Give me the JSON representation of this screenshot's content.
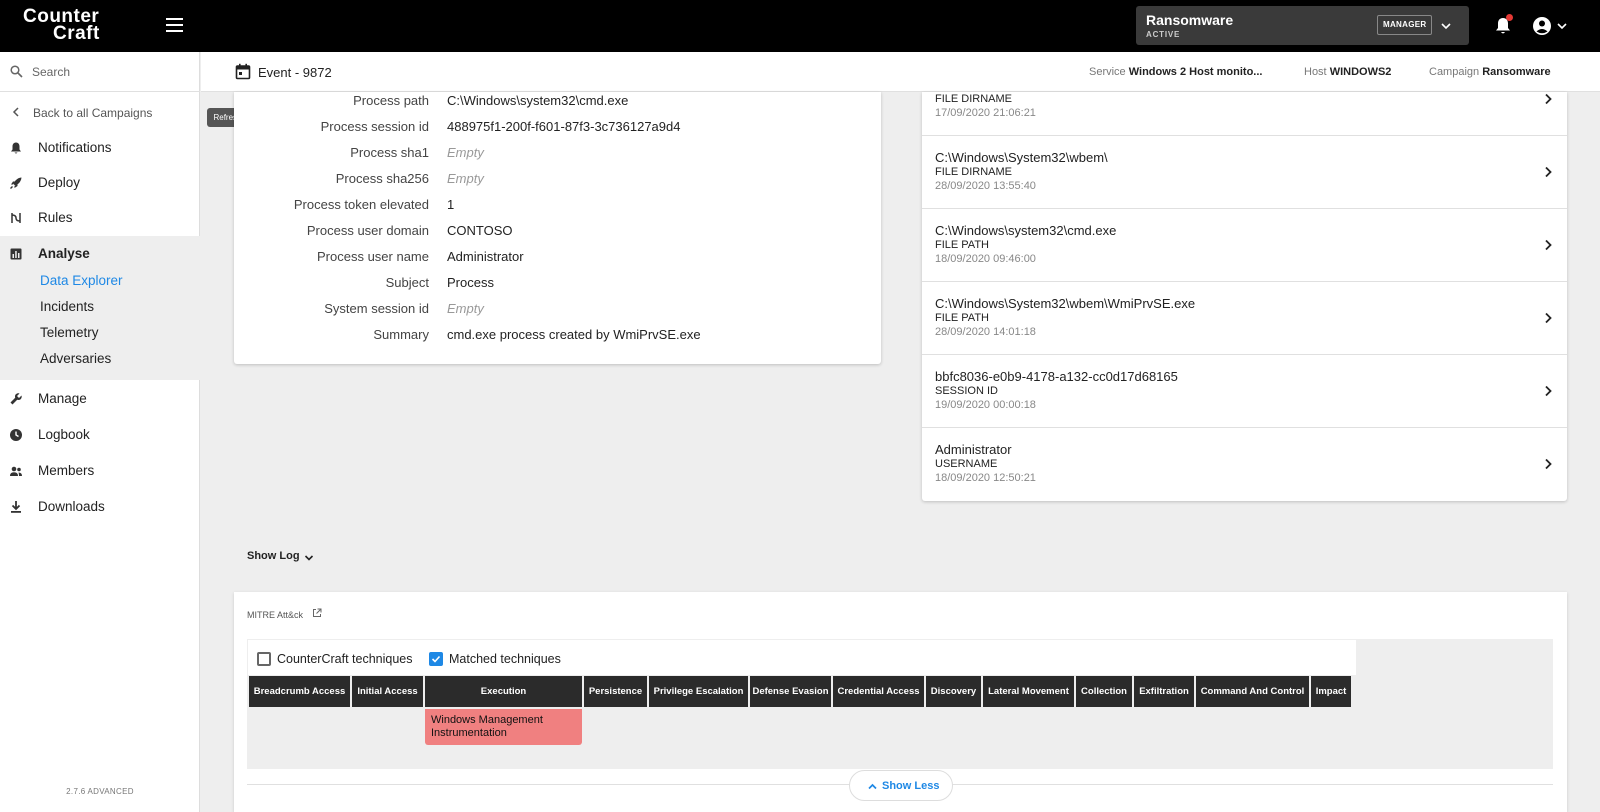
{
  "app": {
    "logo_line1": "Counter",
    "logo_line2": "Craft",
    "version": "2.7.6 ADVANCED"
  },
  "header": {
    "campaign_name": "Ransomware",
    "campaign_status": "ACTIVE",
    "role_badge": "MANAGER"
  },
  "sidebar": {
    "search_placeholder": "Search",
    "back_label": "Back to all Campaigns",
    "refresh_tooltip": "Refresh",
    "items": [
      {
        "label": "Notifications",
        "icon": "bell-icon"
      },
      {
        "label": "Deploy",
        "icon": "rocket-icon"
      },
      {
        "label": "Rules",
        "icon": "rules-icon"
      },
      {
        "label": "Analyse",
        "icon": "chart-icon"
      },
      {
        "label": "Manage",
        "icon": "wrench-icon"
      },
      {
        "label": "Logbook",
        "icon": "clock-icon"
      },
      {
        "label": "Members",
        "icon": "people-icon"
      },
      {
        "label": "Downloads",
        "icon": "download-icon"
      }
    ],
    "analyse_sub": [
      "Data Explorer",
      "Incidents",
      "Telemetry",
      "Adversaries"
    ],
    "active_sub": "Data Explorer"
  },
  "event": {
    "title": "Event - 9872",
    "service_label": "Service",
    "service_value": "Windows 2 Host monito...",
    "host_label": "Host",
    "host_value": "WINDOWS2",
    "campaign_label": "Campaign",
    "campaign_value": "Ransomware"
  },
  "process": {
    "rows": [
      {
        "label": "Process path",
        "value": "C:\\Windows\\system32\\cmd.exe"
      },
      {
        "label": "Process session id",
        "value": "488975f1-200f-f601-87f3-3c736127a9d4"
      },
      {
        "label": "Process sha1",
        "value": "Empty"
      },
      {
        "label": "Process sha256",
        "value": "Empty"
      },
      {
        "label": "Process token elevated",
        "value": "1"
      },
      {
        "label": "Process user domain",
        "value": "CONTOSO"
      },
      {
        "label": "Process user name",
        "value": "Administrator"
      },
      {
        "label": "Subject",
        "value": "Process"
      },
      {
        "label": "System session id",
        "value": "Empty"
      },
      {
        "label": "Summary",
        "value": "cmd.exe process created by WmiPrvSE.exe"
      }
    ]
  },
  "related": {
    "items": [
      {
        "value": "",
        "type": "FILE DIRNAME",
        "date": "17/09/2020 21:06:21"
      },
      {
        "value": "C:\\Windows\\System32\\wbem\\",
        "type": "FILE DIRNAME",
        "date": "28/09/2020 13:55:40"
      },
      {
        "value": "C:\\Windows\\system32\\cmd.exe",
        "type": "FILE PATH",
        "date": "18/09/2020 09:46:00"
      },
      {
        "value": "C:\\Windows\\System32\\wbem\\WmiPrvSE.exe",
        "type": "FILE PATH",
        "date": "28/09/2020 14:01:18"
      },
      {
        "value": "bbfc8036-e0b9-4178-a132-cc0d17d68165",
        "type": "SESSION ID",
        "date": "19/09/2020 00:00:18"
      },
      {
        "value": "Administrator",
        "type": "USERNAME",
        "date": "18/09/2020 12:50:21"
      }
    ]
  },
  "log": {
    "show_log_label": "Show Log"
  },
  "mitre": {
    "title": "MITRE Att&ck",
    "filter_countercraft": "CounterCraft techniques",
    "filter_matched": "Matched techniques",
    "countercraft_checked": false,
    "matched_checked": true,
    "tactics": [
      "Breadcrumb Access",
      "Initial Access",
      "Execution",
      "Persistence",
      "Privilege Escalation",
      "Defense Evasion",
      "Credential Access",
      "Discovery",
      "Lateral Movement",
      "Collection",
      "Exfiltration",
      "Command And Control",
      "Impact"
    ],
    "matched_technique": "Windows Management Instrumentation",
    "matched_tactic": "Execution",
    "show_less_label": "Show Less"
  },
  "colors": {
    "accent": "#1e88e5",
    "technique_match": "#f08080",
    "topbar": "#000000",
    "tactic_header": "#2b2b2b"
  }
}
